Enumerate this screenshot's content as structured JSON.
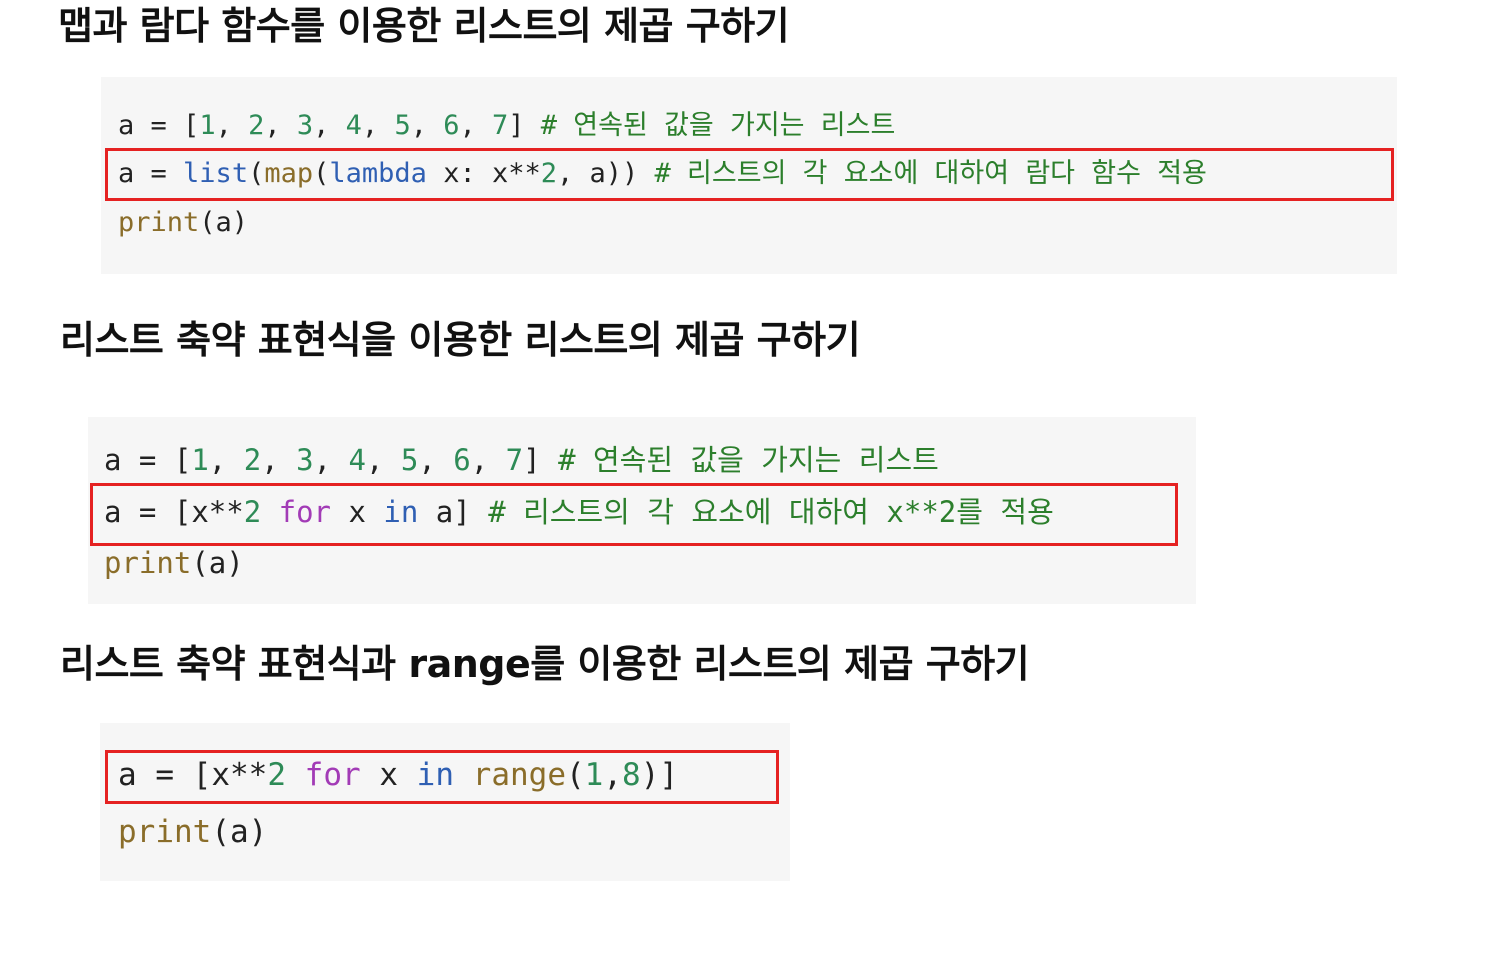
{
  "sections": [
    {
      "heading": "맵과 람다 함수를 이용한 리스트의 제곱 구하기",
      "code": [
        {
          "tokens": [
            {
              "t": "a",
              "c": "var"
            },
            {
              "t": " = ",
              "c": "op"
            },
            {
              "t": "[",
              "c": "punct"
            },
            {
              "t": "1",
              "c": "num"
            },
            {
              "t": ", ",
              "c": "punct"
            },
            {
              "t": "2",
              "c": "num"
            },
            {
              "t": ", ",
              "c": "punct"
            },
            {
              "t": "3",
              "c": "num"
            },
            {
              "t": ", ",
              "c": "punct"
            },
            {
              "t": "4",
              "c": "num"
            },
            {
              "t": ", ",
              "c": "punct"
            },
            {
              "t": "5",
              "c": "num"
            },
            {
              "t": ", ",
              "c": "punct"
            },
            {
              "t": "6",
              "c": "num"
            },
            {
              "t": ", ",
              "c": "punct"
            },
            {
              "t": "7",
              "c": "num"
            },
            {
              "t": "] ",
              "c": "punct"
            },
            {
              "t": "# 연속된 값을 가지는 리스트",
              "c": "comment"
            }
          ]
        },
        {
          "highlighted": true,
          "tokens": [
            {
              "t": "a",
              "c": "var"
            },
            {
              "t": " = ",
              "c": "op"
            },
            {
              "t": "list",
              "c": "builtin"
            },
            {
              "t": "(",
              "c": "punct"
            },
            {
              "t": "map",
              "c": "func"
            },
            {
              "t": "(",
              "c": "punct"
            },
            {
              "t": "lambda",
              "c": "builtin"
            },
            {
              "t": " x: x**",
              "c": "var"
            },
            {
              "t": "2",
              "c": "num"
            },
            {
              "t": ", a)) ",
              "c": "var"
            },
            {
              "t": "# 리스트의 각 요소에 대하여 람다 함수 적용",
              "c": "comment"
            }
          ]
        },
        {
          "tokens": [
            {
              "t": "print",
              "c": "print"
            },
            {
              "t": "(a)",
              "c": "punct"
            }
          ]
        }
      ]
    },
    {
      "heading": "리스트 축약 표현식을 이용한 리스트의 제곱 구하기",
      "code": [
        {
          "tokens": [
            {
              "t": "a",
              "c": "var"
            },
            {
              "t": " = ",
              "c": "op"
            },
            {
              "t": "[",
              "c": "punct"
            },
            {
              "t": "1",
              "c": "num"
            },
            {
              "t": ", ",
              "c": "punct"
            },
            {
              "t": "2",
              "c": "num"
            },
            {
              "t": ", ",
              "c": "punct"
            },
            {
              "t": "3",
              "c": "num"
            },
            {
              "t": ", ",
              "c": "punct"
            },
            {
              "t": "4",
              "c": "num"
            },
            {
              "t": ", ",
              "c": "punct"
            },
            {
              "t": "5",
              "c": "num"
            },
            {
              "t": ", ",
              "c": "punct"
            },
            {
              "t": "6",
              "c": "num"
            },
            {
              "t": ", ",
              "c": "punct"
            },
            {
              "t": "7",
              "c": "num"
            },
            {
              "t": "] ",
              "c": "punct"
            },
            {
              "t": "# 연속된 값을 가지는 리스트",
              "c": "comment"
            }
          ]
        },
        {
          "highlighted": true,
          "tokens": [
            {
              "t": "a",
              "c": "var"
            },
            {
              "t": " = ",
              "c": "op"
            },
            {
              "t": "[x**",
              "c": "var"
            },
            {
              "t": "2",
              "c": "num"
            },
            {
              "t": " ",
              "c": "var"
            },
            {
              "t": "for",
              "c": "keyword"
            },
            {
              "t": " x ",
              "c": "var"
            },
            {
              "t": "in",
              "c": "builtin"
            },
            {
              "t": " a] ",
              "c": "var"
            },
            {
              "t": "# 리스트의 각 요소에 대하여 x**2를 적용",
              "c": "comment"
            }
          ]
        },
        {
          "tokens": [
            {
              "t": "print",
              "c": "print"
            },
            {
              "t": "(a)",
              "c": "punct"
            }
          ]
        }
      ]
    },
    {
      "heading": "리스트 축약 표현식과 range를 이용한 리스트의 제곱 구하기",
      "code": [
        {
          "highlighted": true,
          "tokens": [
            {
              "t": "a",
              "c": "var"
            },
            {
              "t": " = ",
              "c": "op"
            },
            {
              "t": "[x**",
              "c": "var"
            },
            {
              "t": "2",
              "c": "num"
            },
            {
              "t": " ",
              "c": "var"
            },
            {
              "t": "for",
              "c": "keyword"
            },
            {
              "t": " x ",
              "c": "var"
            },
            {
              "t": "in",
              "c": "builtin"
            },
            {
              "t": " ",
              "c": "var"
            },
            {
              "t": "range",
              "c": "func"
            },
            {
              "t": "(",
              "c": "punct"
            },
            {
              "t": "1",
              "c": "num"
            },
            {
              "t": ",",
              "c": "punct"
            },
            {
              "t": "8",
              "c": "num"
            },
            {
              "t": ")]",
              "c": "punct"
            }
          ]
        },
        {
          "tokens": [
            {
              "t": "print",
              "c": "print"
            },
            {
              "t": "(a)",
              "c": "punct"
            }
          ]
        }
      ]
    }
  ],
  "colors": {
    "highlight_border": "#e52222",
    "code_background": "#f6f6f6",
    "comment": "#2c7f2c",
    "number": "#2e8b57",
    "builtin": "#2f5fb3",
    "keyword": "#a23bb6",
    "function": "#8a6d2a"
  }
}
